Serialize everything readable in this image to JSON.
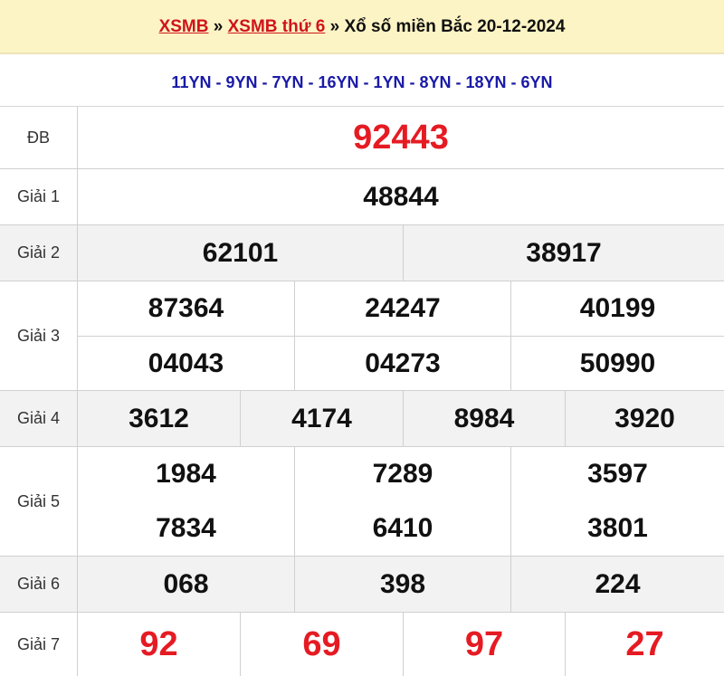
{
  "header": {
    "link1": "XSMB",
    "sep1": " » ",
    "link2": "XSMB thứ 6",
    "rest": " » Xổ số miền Bắc 20-12-2024"
  },
  "codes": "11YN - 9YN - 7YN - 16YN - 1YN - 8YN - 18YN - 6YN",
  "prizes": {
    "db": {
      "label": "ĐB",
      "values": [
        "92443"
      ]
    },
    "g1": {
      "label": "Giải 1",
      "values": [
        "48844"
      ]
    },
    "g2": {
      "label": "Giải 2",
      "values": [
        "62101",
        "38917"
      ]
    },
    "g3": {
      "label": "Giải 3",
      "values": [
        "87364",
        "24247",
        "40199",
        "04043",
        "04273",
        "50990"
      ]
    },
    "g4": {
      "label": "Giải 4",
      "values": [
        "3612",
        "4174",
        "8984",
        "3920"
      ]
    },
    "g5": {
      "label": "Giải 5",
      "values": [
        "1984",
        "7289",
        "3597",
        "7834",
        "6410",
        "3801"
      ]
    },
    "g6": {
      "label": "Giải 6",
      "values": [
        "068",
        "398",
        "224"
      ]
    },
    "g7": {
      "label": "Giải 7",
      "values": [
        "92",
        "69",
        "97",
        "27"
      ]
    }
  },
  "colors": {
    "accent_red": "#e51b23",
    "header_bg": "#fdf4c5",
    "code_blue": "#1a1aa8"
  }
}
